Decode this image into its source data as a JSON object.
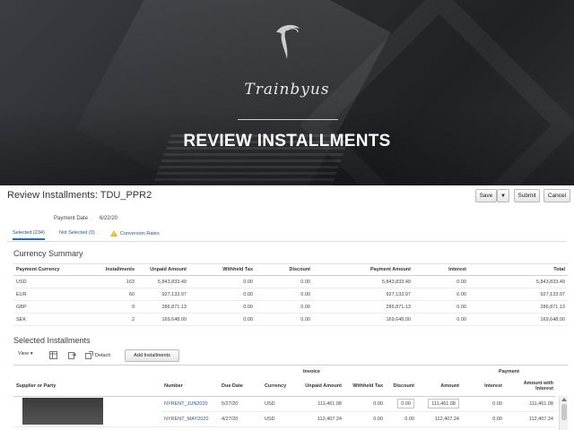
{
  "banner": {
    "brand": "Trainbyus",
    "title": "REVIEW INSTALLMENTS"
  },
  "page": {
    "title": "Review Installments: TDU_PPR2",
    "buttons": {
      "save": "Save",
      "submit": "Submit",
      "cancel": "Cancel"
    },
    "payment_date_label": "Payment Date",
    "payment_date_value": "6/22/20"
  },
  "tabs": [
    {
      "label": "Selected (234)",
      "active": true
    },
    {
      "label": "Not Selected (0)",
      "active": false
    },
    {
      "label": "Conversion Rates",
      "active": false
    }
  ],
  "currency_summary": {
    "title": "Currency Summary",
    "columns": [
      "Payment Currency",
      "Installments",
      "Unpaid Amount",
      "Withheld Tax",
      "Discount",
      "Payment Amount",
      "Interest",
      "Total"
    ],
    "rows": [
      [
        "USD",
        "163",
        "5,843,833.49",
        "0.00",
        "0.00",
        "5,843,833.49",
        "0.00",
        "5,843,833.49"
      ],
      [
        "EUR",
        "60",
        "927,133.97",
        "0.00",
        "0.00",
        "927,133.97",
        "0.00",
        "927,133.97"
      ],
      [
        "GBP",
        "9",
        "286,871.13",
        "0.00",
        "0.00",
        "286,871.13",
        "0.00",
        "286,871.13"
      ],
      [
        "SEK",
        "2",
        "169,648.00",
        "0.00",
        "0.00",
        "169,648.00",
        "0.00",
        "169,648.00"
      ]
    ]
  },
  "selected_installments": {
    "title": "Selected Installments",
    "toolbar": {
      "view": "View",
      "detach": "Detach",
      "add": "Add Installments"
    },
    "group_invoice": "Invoice",
    "group_payment": "Payment",
    "columns": {
      "supplier": "Supplier or Party",
      "number": "Number",
      "due_date": "Due Date",
      "currency": "Currency",
      "unpaid": "Unpaid Amount",
      "withheld": "Withheld Tax",
      "discount": "Discount",
      "amount": "Amount",
      "interest": "Interest",
      "amount_interest": "Amount with Interest"
    },
    "rows": [
      {
        "number": "NYRENT_JUN2020",
        "due_date": "5/27/20",
        "currency": "USD",
        "unpaid": "111,461.08",
        "withheld": "0.00",
        "discount": "0.00",
        "amount": "111,461.08",
        "interest": "0.00",
        "amount_interest": "111,461.08"
      },
      {
        "number": "NYRENT_MAY2020",
        "due_date": "4/27/20",
        "currency": "USD",
        "unpaid": "112,407.24",
        "withheld": "0.00",
        "discount": "0.00",
        "amount": "112,407.24",
        "interest": "0.00",
        "amount_interest": "112,407.24"
      }
    ]
  }
}
